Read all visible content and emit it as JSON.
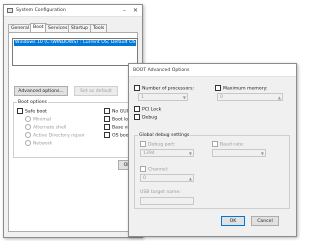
{
  "main_window": {
    "title": "System Configuration",
    "controls": {
      "minimize": "–",
      "close": "✕"
    },
    "tabs": [
      "General",
      "Boot",
      "Services",
      "Startup",
      "Tools"
    ],
    "active_tab": "Boot",
    "os_entry": "Windows 10 (C:\\WINDOWS) : Current OS; Default OS",
    "buttons": {
      "advanced": "Advanced options...",
      "set_default": "Set as default"
    },
    "boot_options": {
      "label": "Boot options",
      "safe_boot": "Safe boot",
      "minimal": "Minimal",
      "alternate_shell": "Alternate shell",
      "ad_repair": "Active Directory repair",
      "network": "Network",
      "no_gui": "No GUI",
      "boot_log": "Boot log",
      "base_video": "Base video",
      "os_boot": "OS boot"
    },
    "ok_label": "OK"
  },
  "advanced_dialog": {
    "title": "BOOT Advanced Options",
    "num_processors": {
      "label": "Number of processors:",
      "value": "1"
    },
    "max_memory": {
      "label": "Maximum memory:",
      "value": "0"
    },
    "pci_lock": "PCI Lock",
    "debug": "Debug",
    "global_debug": {
      "label": "Global debug settings",
      "debug_port": {
        "label": "Debug port:",
        "value": "1394"
      },
      "baud_rate": {
        "label": "Baud rate:",
        "value": ""
      },
      "channel": {
        "label": "Channel:",
        "value": "0"
      },
      "usb_target": {
        "label": "USB target name:",
        "value": ""
      }
    },
    "buttons": {
      "ok": "OK",
      "cancel": "Cancel"
    }
  }
}
